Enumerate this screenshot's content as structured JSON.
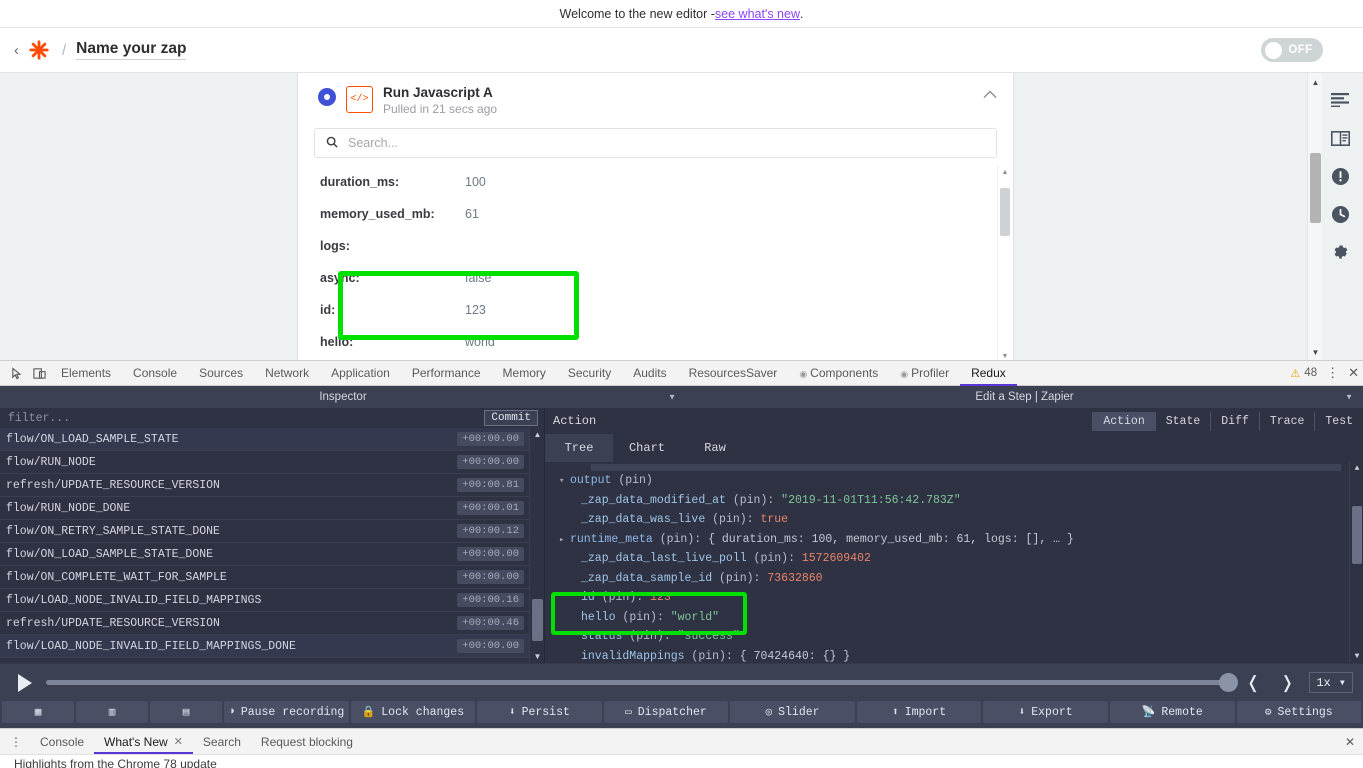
{
  "zapier": {
    "banner": {
      "text": "Welcome to the new editor - ",
      "link": "see what's new",
      "suffix": "."
    },
    "header": {
      "back_icon": "‹",
      "slash": "/",
      "title": "Name your zap",
      "toggle_label": "OFF"
    },
    "step": {
      "title": "Run Javascript A",
      "subtitle": "Pulled in 21 secs ago",
      "app_icon_glyph": "</>",
      "collapse_icon": "^",
      "search_placeholder": "Search...",
      "search_value": ""
    },
    "fields": [
      {
        "key": "duration_ms:",
        "value": "100"
      },
      {
        "key": "memory_used_mb:",
        "value": "61"
      },
      {
        "key": "logs:",
        "value": ""
      },
      {
        "key": "async:",
        "value": "false"
      },
      {
        "key": "id:",
        "value": "123"
      },
      {
        "key": "hello:",
        "value": "world"
      }
    ],
    "rail_icons": [
      "lines-icon",
      "book-icon",
      "alert-circle-icon",
      "clock-icon",
      "gear-icon"
    ]
  },
  "devtools": {
    "tabs": [
      {
        "label": "Elements",
        "active": false,
        "dot": false
      },
      {
        "label": "Console",
        "active": false,
        "dot": false
      },
      {
        "label": "Sources",
        "active": false,
        "dot": false
      },
      {
        "label": "Network",
        "active": false,
        "dot": false
      },
      {
        "label": "Application",
        "active": false,
        "dot": false
      },
      {
        "label": "Performance",
        "active": false,
        "dot": false
      },
      {
        "label": "Memory",
        "active": false,
        "dot": false
      },
      {
        "label": "Security",
        "active": false,
        "dot": false
      },
      {
        "label": "Audits",
        "active": false,
        "dot": false
      },
      {
        "label": "ResourcesSaver",
        "active": false,
        "dot": false
      },
      {
        "label": "Components",
        "active": false,
        "dot": true
      },
      {
        "label": "Profiler",
        "active": false,
        "dot": true
      },
      {
        "label": "Redux",
        "active": true,
        "dot": false
      }
    ],
    "warning_count": "48",
    "kebab": "⋮",
    "close": "✕"
  },
  "redux": {
    "left_title": "Inspector",
    "right_title": "Edit a Step | Zapier",
    "filter_placeholder": "filter...",
    "filter_value": "",
    "commit_label": "Commit",
    "actions": [
      {
        "name": "flow/ON_LOAD_SAMPLE_STATE",
        "time": "+00:00.00"
      },
      {
        "name": "flow/RUN_NODE",
        "time": "+00:00.00"
      },
      {
        "name": "refresh/UPDATE_RESOURCE_VERSION",
        "time": "+00:00.81"
      },
      {
        "name": "flow/RUN_NODE_DONE",
        "time": "+00:00.01"
      },
      {
        "name": "flow/ON_RETRY_SAMPLE_STATE_DONE",
        "time": "+00:00.12"
      },
      {
        "name": "flow/ON_LOAD_SAMPLE_STATE_DONE",
        "time": "+00:00.00"
      },
      {
        "name": "flow/ON_COMPLETE_WAIT_FOR_SAMPLE",
        "time": "+00:00.00"
      },
      {
        "name": "flow/LOAD_NODE_INVALID_FIELD_MAPPINGS",
        "time": "+00:00.16"
      },
      {
        "name": "refresh/UPDATE_RESOURCE_VERSION",
        "time": "+00:00.46"
      },
      {
        "name": "flow/LOAD_NODE_INVALID_FIELD_MAPPINGS_DONE",
        "time": "+00:00.00"
      }
    ],
    "inspector_label": "Action",
    "segments": [
      {
        "label": "Action",
        "active": true
      },
      {
        "label": "State",
        "active": false
      },
      {
        "label": "Diff",
        "active": false
      },
      {
        "label": "Trace",
        "active": false
      },
      {
        "label": "Test",
        "active": false
      }
    ],
    "sub_tabs": [
      {
        "label": "Tree",
        "active": true
      },
      {
        "label": "Chart",
        "active": false
      },
      {
        "label": "Raw",
        "active": false
      }
    ],
    "tree": [
      {
        "indent": 0,
        "arrow": "▾",
        "key": "output",
        "pin": " (pin)",
        "sep": "",
        "value": "",
        "vtype": "none"
      },
      {
        "indent": 1,
        "arrow": "",
        "key": "_zap_data_modified_at",
        "pin": " (pin)",
        "sep": ": ",
        "value": "\"2019-11-01T11:56:42.783Z\"",
        "vtype": "str"
      },
      {
        "indent": 1,
        "arrow": "",
        "key": "_zap_data_was_live",
        "pin": " (pin)",
        "sep": ": ",
        "value": "true",
        "vtype": "bool"
      },
      {
        "indent": 0,
        "arrow": "▸",
        "key": "runtime_meta",
        "pin": " (pin)",
        "sep": ": ",
        "value": "{ duration_ms: 100, memory_used_mb: 61, logs: [], … }",
        "vtype": "meta"
      },
      {
        "indent": 1,
        "arrow": "",
        "key": "_zap_data_last_live_poll",
        "pin": " (pin)",
        "sep": ": ",
        "value": "1572609402",
        "vtype": "num"
      },
      {
        "indent": 1,
        "arrow": "",
        "key": "_zap_data_sample_id",
        "pin": " (pin)",
        "sep": ": ",
        "value": "73632860",
        "vtype": "num"
      },
      {
        "indent": 1,
        "arrow": "",
        "key": "id",
        "pin": " (pin)",
        "sep": ": ",
        "value": "123",
        "vtype": "num"
      },
      {
        "indent": 1,
        "arrow": "",
        "key": "hello",
        "pin": " (pin)",
        "sep": ": ",
        "value": "\"world\"",
        "vtype": "str"
      },
      {
        "indent": 1,
        "arrow": "",
        "key": "status",
        "pin": " (pin)",
        "sep": ": ",
        "value": "\"success\"",
        "vtype": "str"
      },
      {
        "indent": 1,
        "arrow": "",
        "key": "invalidMappings",
        "pin": " (pin)",
        "sep": ": ",
        "value": "{ 70424640: {} }",
        "vtype": "meta"
      }
    ],
    "playback": {
      "play_icon": "play-icon",
      "prev": "❬",
      "next": "❭",
      "speed": "1x",
      "speed_caret": "▾"
    },
    "bottom_buttons": [
      {
        "icon": "dock-bottom-icon",
        "label": "",
        "glyph": "▦"
      },
      {
        "icon": "dock-right-icon",
        "label": "",
        "glyph": "▥"
      },
      {
        "icon": "dock-undock-icon",
        "label": "",
        "glyph": "▤"
      },
      {
        "icon": "pause-icon",
        "label": "Pause recording",
        "glyph": "◑"
      },
      {
        "icon": "lock-icon",
        "label": "Lock changes",
        "glyph": "🔒"
      },
      {
        "icon": "persist-icon",
        "label": "Persist",
        "glyph": "⬇"
      },
      {
        "icon": "dispatcher-icon",
        "label": "Dispatcher",
        "glyph": "▭"
      },
      {
        "icon": "slider-icon",
        "label": "Slider",
        "glyph": "◎"
      },
      {
        "icon": "import-icon",
        "label": "Import",
        "glyph": "⬆"
      },
      {
        "icon": "export-icon",
        "label": "Export",
        "glyph": "⬇"
      },
      {
        "icon": "remote-icon",
        "label": "Remote",
        "glyph": "📡"
      },
      {
        "icon": "settings-icon",
        "label": "Settings",
        "glyph": "⚙"
      }
    ]
  },
  "drawer": {
    "kebab": "⋮",
    "tabs": [
      {
        "label": "Console",
        "active": false,
        "closable": false
      },
      {
        "label": "What's New",
        "active": true,
        "closable": true
      },
      {
        "label": "Search",
        "active": false,
        "closable": false
      },
      {
        "label": "Request blocking",
        "active": false,
        "closable": false
      }
    ],
    "close": "✕",
    "content": "Highlights from the Chrome 78 update"
  }
}
